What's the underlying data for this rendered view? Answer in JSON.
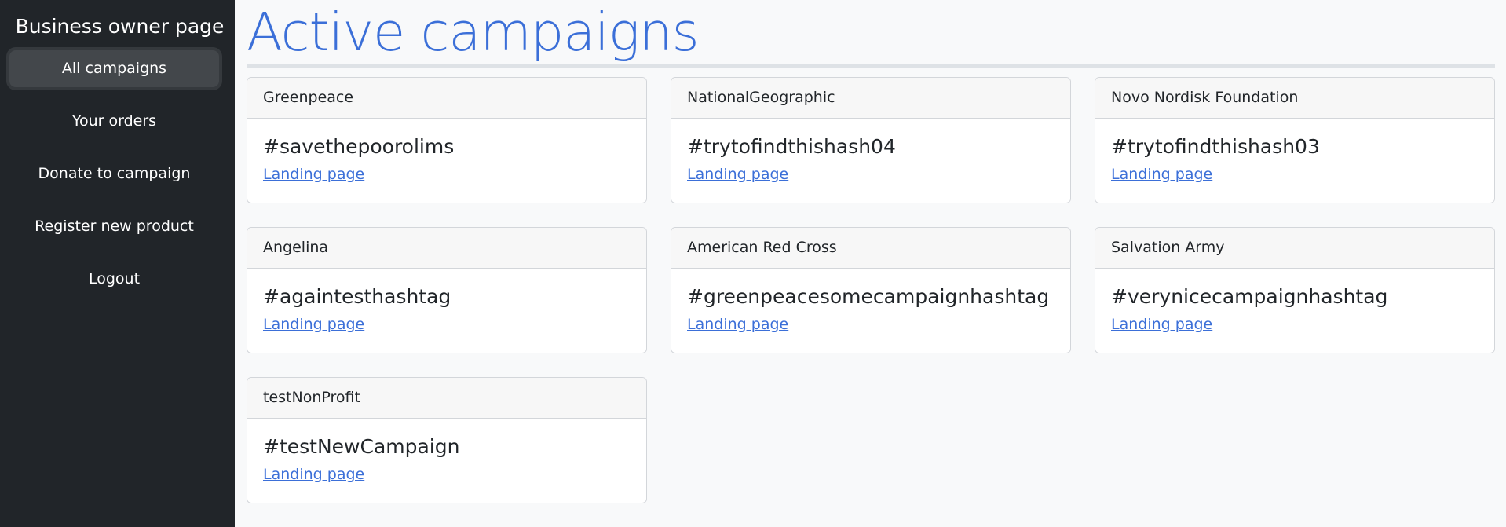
{
  "sidebar": {
    "title": "Business owner page",
    "items": [
      {
        "label": "All campaigns",
        "active": true
      },
      {
        "label": "Your orders",
        "active": false
      },
      {
        "label": "Donate to campaign",
        "active": false
      },
      {
        "label": "Register new product",
        "active": false
      },
      {
        "label": "Logout",
        "active": false
      }
    ]
  },
  "main": {
    "title": "Active campaigns",
    "cards": [
      {
        "organization": "Greenpeace",
        "hashtag": "#savethepoorolims",
        "link": "Landing page"
      },
      {
        "organization": "NationalGeographic",
        "hashtag": "#trytofindthishash04",
        "link": "Landing page"
      },
      {
        "organization": "Novo Nordisk Foundation",
        "hashtag": "#trytofindthishash03",
        "link": "Landing page"
      },
      {
        "organization": "Angelina",
        "hashtag": "#againtesthashtag",
        "link": "Landing page"
      },
      {
        "organization": "American Red Cross",
        "hashtag": "#greenpeacesomecampaignhashtag",
        "link": "Landing page"
      },
      {
        "organization": "Salvation Army",
        "hashtag": "#verynicecampaignhashtag",
        "link": "Landing page"
      },
      {
        "organization": "testNonProfit",
        "hashtag": "#testNewCampaign",
        "link": "Landing page"
      }
    ]
  },
  "colors": {
    "sidebar_bg": "#212529",
    "accent": "#3b6fd8",
    "page_bg": "#f8f9fa"
  }
}
